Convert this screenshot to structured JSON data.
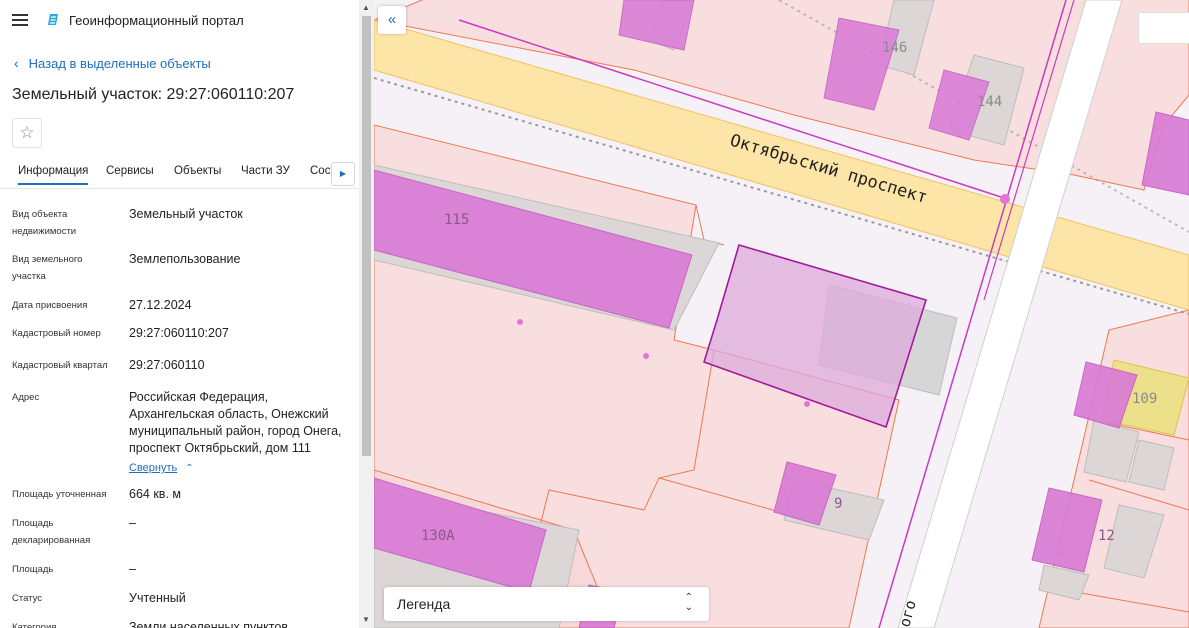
{
  "app": {
    "title": "Геоинформационный портал"
  },
  "nav": {
    "back_label": "Назад в выделенные объекты"
  },
  "object": {
    "title": "Земельный участок: 29:27:060110:207"
  },
  "tabs": [
    {
      "label": "Информация",
      "active": true
    },
    {
      "label": "Сервисы"
    },
    {
      "label": "Объекты"
    },
    {
      "label": "Части ЗУ"
    },
    {
      "label": "Сост"
    }
  ],
  "info": {
    "rows": [
      {
        "label": "Вид объекта недвижимости",
        "value": "Земельный участок"
      },
      {
        "label": "Вид земельного участка",
        "value": "Землепользование"
      },
      {
        "label": "Дата присвоения",
        "value": "27.12.2024"
      },
      {
        "label": "Кадастровый номер",
        "value": "29:27:060110:207"
      },
      {
        "label": "Кадастровый квартал",
        "value": "29:27:060110"
      },
      {
        "label": "Адрес",
        "value": "Российская Федерация, Архангельская область, Онежский муниципальный район, город Онега, проспект Октябрьский, дом 111"
      },
      {
        "label": "Площадь уточненная",
        "value": "664 кв. м"
      },
      {
        "label": "Площадь декларированная",
        "value": "–"
      },
      {
        "label": "Площадь",
        "value": "–"
      },
      {
        "label": "Статус",
        "value": "Учтенный"
      },
      {
        "label": "Категория",
        "value": "Земли населенных пунктов"
      }
    ],
    "collapse_label": "Свернуть"
  },
  "map": {
    "street_label": "Октябрьский проспект",
    "street2_label": "ого",
    "house_labels": [
      "146",
      "144",
      "115",
      "109",
      "130А",
      "9",
      "12"
    ],
    "legend_label": "Легенда"
  },
  "colors": {
    "accent": "#1f6fbf",
    "road": "#fde5a8",
    "parcel_fill": "#d97ad6",
    "parcel_border": "#f07850",
    "building": "#d8d8d8"
  }
}
